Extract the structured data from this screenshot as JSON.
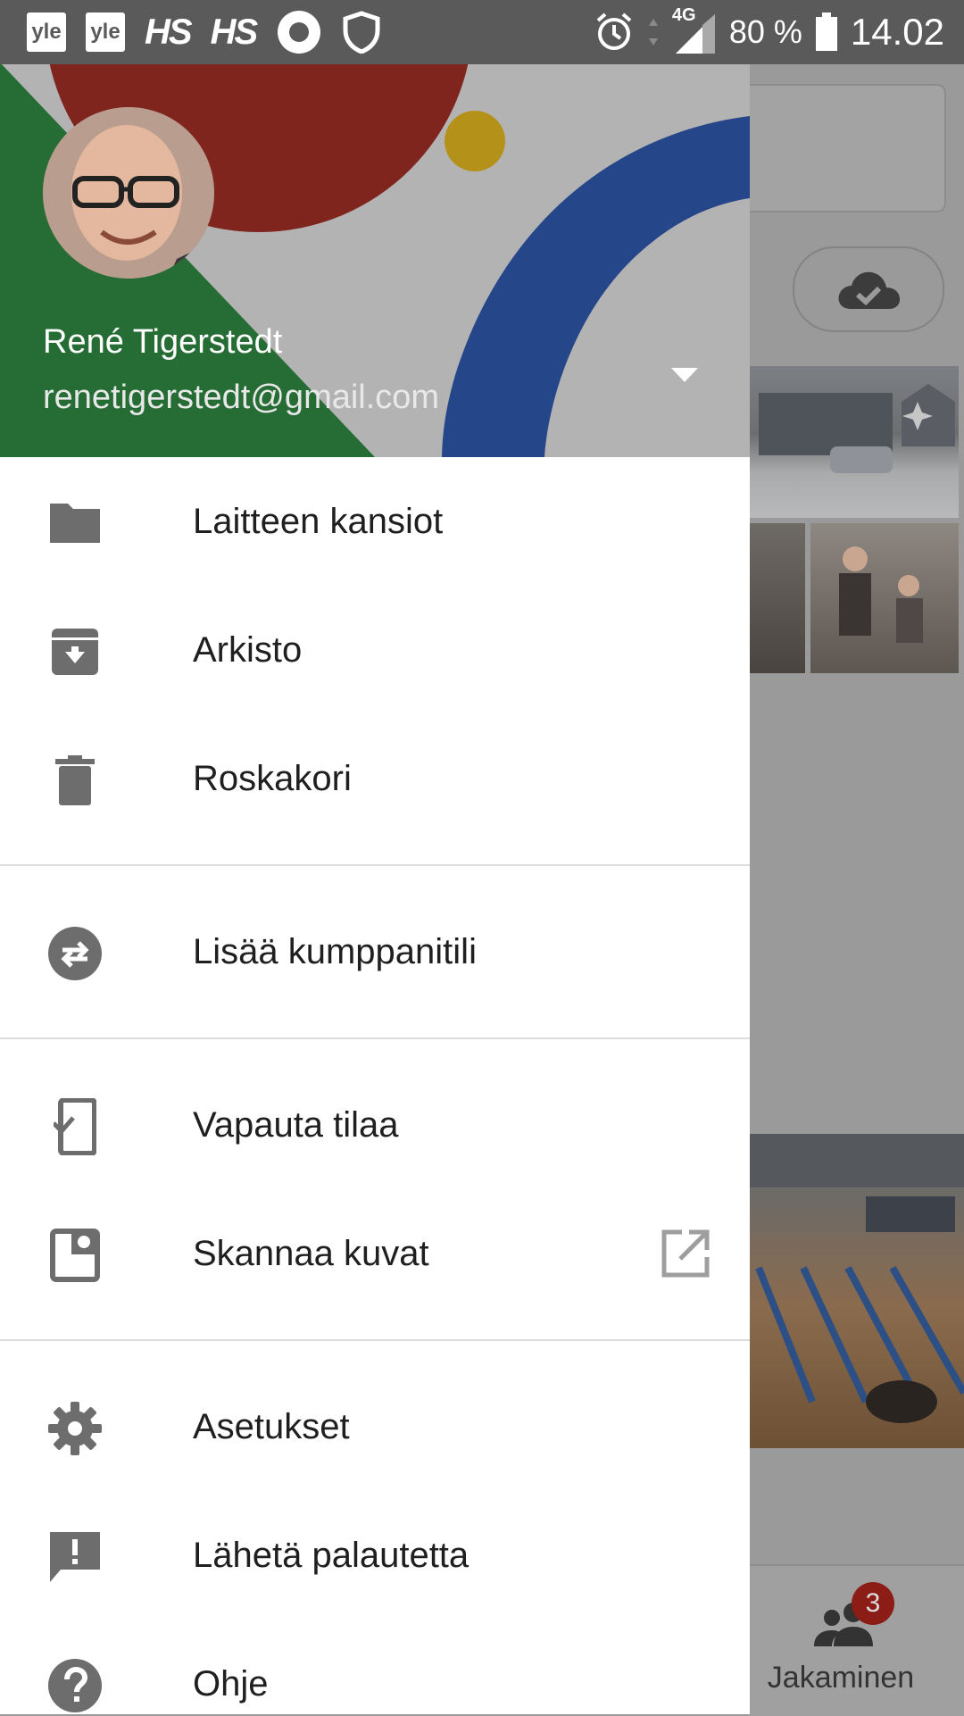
{
  "status_bar": {
    "notification_icons": [
      "yle",
      "yle",
      "HS",
      "HS"
    ],
    "network": "4G",
    "battery": "80 %",
    "time": "14.02"
  },
  "account": {
    "name": "René Tigerstedt",
    "email": "renetigerstedt@gmail.com"
  },
  "menu": {
    "device_folders": "Laitteen kansiot",
    "archive": "Arkisto",
    "trash": "Roskakori",
    "partner_account": "Lisää kumppanitili",
    "free_up_space": "Vapauta tilaa",
    "scan_photos": "Skannaa kuvat",
    "settings": "Asetukset",
    "send_feedback": "Lähetä palautetta",
    "help": "Ohje"
  },
  "background_app": {
    "bottom_nav_label": "Jakaminen",
    "sharing_badge": "3"
  },
  "colors": {
    "status_bar": "#5a5a5a",
    "header_red": "#8e2a22",
    "header_blue": "#2a4f98",
    "header_green": "#2a7a3a",
    "header_yellow": "#c9a21c",
    "icon_gray": "#6d6d6d",
    "label_text": "#1f1f1f",
    "scrim": "#9a9a9a"
  }
}
